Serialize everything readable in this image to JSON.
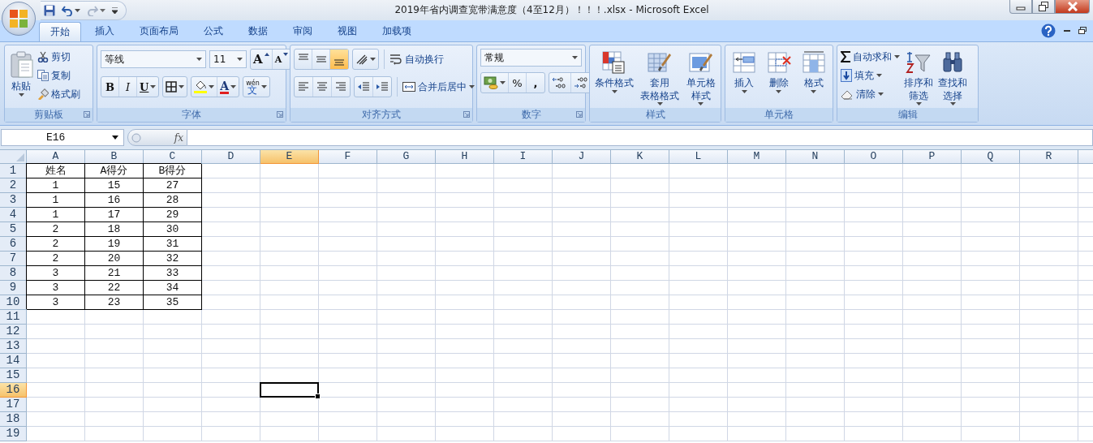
{
  "window": {
    "title": "2019年省内调查宽带满意度（4至12月）！！！.xlsx - Microsoft Excel"
  },
  "tabs": [
    {
      "label": "开始",
      "selected": true
    },
    {
      "label": "插入",
      "selected": false
    },
    {
      "label": "页面布局",
      "selected": false
    },
    {
      "label": "公式",
      "selected": false
    },
    {
      "label": "数据",
      "selected": false
    },
    {
      "label": "审阅",
      "selected": false
    },
    {
      "label": "视图",
      "selected": false
    },
    {
      "label": "加载项",
      "selected": false
    }
  ],
  "ribbon": {
    "clipboard": {
      "label": "剪贴板",
      "paste": "粘贴",
      "cut": "剪切",
      "copy": "复制",
      "format_painter": "格式刷"
    },
    "font": {
      "label": "字体",
      "font_name": "等线",
      "font_size": "11",
      "grow": "A",
      "shrink": "A",
      "bold": "B",
      "italic": "I",
      "underline": "U",
      "font_color": "A",
      "phonetic_reading": "wén",
      "phonetic": "文"
    },
    "alignment": {
      "label": "对齐方式",
      "vertical": [
        {
          "selected": false
        },
        {
          "selected": false
        },
        {
          "selected": true
        }
      ],
      "wrap_text": "自动换行",
      "merge_center": "合并后居中"
    },
    "number": {
      "label": "数字",
      "format": "常规",
      "percent": "%",
      "comma": ","
    },
    "styles": {
      "label": "样式",
      "buttons": [
        [
          "条件格式"
        ],
        [
          "套用",
          "表格格式"
        ],
        [
          "单元格",
          "样式"
        ]
      ]
    },
    "cells": {
      "label": "单元格",
      "buttons": [
        [
          "插入"
        ],
        [
          "删除"
        ],
        [
          "格式"
        ]
      ]
    },
    "editing": {
      "label": "编辑",
      "autosum": "自动求和",
      "fill": "填充",
      "clear": "清除",
      "sort_filter": [
        "排序和",
        "筛选"
      ],
      "find_select": [
        "查找和",
        "选择"
      ]
    }
  },
  "formula_bar": {
    "name_box": "E16",
    "fx": "fx"
  },
  "sheet": {
    "columns": [
      {
        "label": "A",
        "selected": false
      },
      {
        "label": "B",
        "selected": false
      },
      {
        "label": "C",
        "selected": false
      },
      {
        "label": "D",
        "selected": false
      },
      {
        "label": "E",
        "selected": true
      },
      {
        "label": "F",
        "selected": false
      },
      {
        "label": "G",
        "selected": false
      },
      {
        "label": "H",
        "selected": false
      },
      {
        "label": "I",
        "selected": false
      },
      {
        "label": "J",
        "selected": false
      },
      {
        "label": "K",
        "selected": false
      },
      {
        "label": "L",
        "selected": false
      },
      {
        "label": "M",
        "selected": false
      },
      {
        "label": "N",
        "selected": false
      },
      {
        "label": "O",
        "selected": false
      },
      {
        "label": "P",
        "selected": false
      },
      {
        "label": "Q",
        "selected": false
      },
      {
        "label": "R",
        "selected": false
      }
    ],
    "rows": [
      {
        "label": "1",
        "selected": false,
        "cells": [
          "姓名",
          "A得分",
          "B得分"
        ]
      },
      {
        "label": "2",
        "selected": false,
        "cells": [
          "1",
          "15",
          "27"
        ]
      },
      {
        "label": "3",
        "selected": false,
        "cells": [
          "1",
          "16",
          "28"
        ]
      },
      {
        "label": "4",
        "selected": false,
        "cells": [
          "1",
          "17",
          "29"
        ]
      },
      {
        "label": "5",
        "selected": false,
        "cells": [
          "2",
          "18",
          "30"
        ]
      },
      {
        "label": "6",
        "selected": false,
        "cells": [
          "2",
          "19",
          "31"
        ]
      },
      {
        "label": "7",
        "selected": false,
        "cells": [
          "2",
          "20",
          "32"
        ]
      },
      {
        "label": "8",
        "selected": false,
        "cells": [
          "3",
          "21",
          "33"
        ]
      },
      {
        "label": "9",
        "selected": false,
        "cells": [
          "3",
          "22",
          "34"
        ]
      },
      {
        "label": "10",
        "selected": false,
        "cells": [
          "3",
          "23",
          "35"
        ]
      },
      {
        "label": "11",
        "selected": false
      },
      {
        "label": "12",
        "selected": false
      },
      {
        "label": "13",
        "selected": false
      },
      {
        "label": "14",
        "selected": false
      },
      {
        "label": "15",
        "selected": false
      },
      {
        "label": "16",
        "selected": true
      },
      {
        "label": "17",
        "selected": false
      },
      {
        "label": "18",
        "selected": false
      },
      {
        "label": "19",
        "selected": false
      }
    ]
  }
}
